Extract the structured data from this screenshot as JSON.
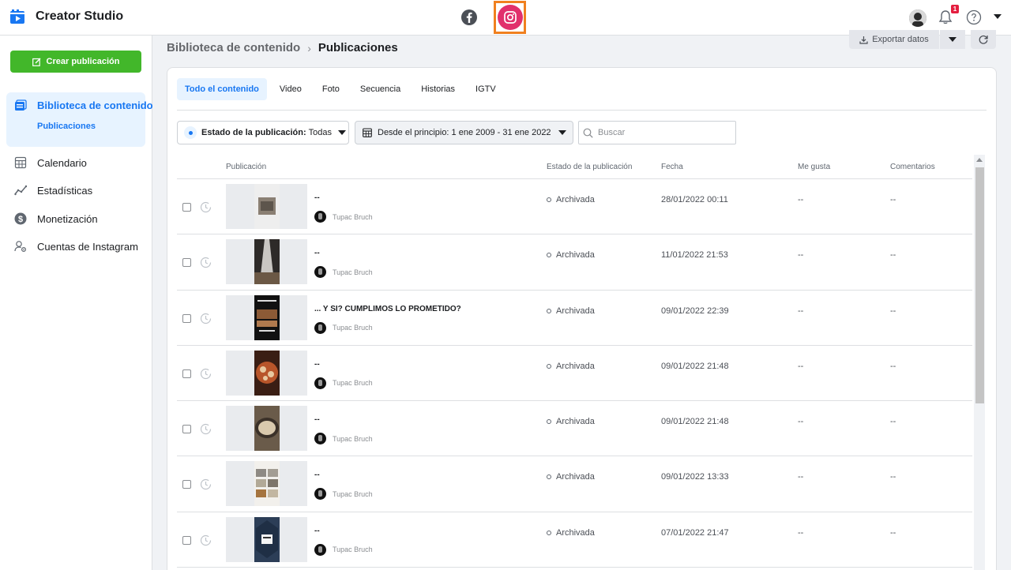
{
  "app": {
    "title": "Creator Studio"
  },
  "topbar": {
    "notification_count": "1"
  },
  "sidebar": {
    "create_label": "Crear publicación",
    "active_item": {
      "label": "Biblioteca de contenido",
      "sub": "Publicaciones"
    },
    "items": [
      {
        "label": "Calendario",
        "icon": "calendar-icon"
      },
      {
        "label": "Estadísticas",
        "icon": "stats-icon"
      },
      {
        "label": "Monetización",
        "icon": "dollar-icon"
      },
      {
        "label": "Cuentas de Instagram",
        "icon": "account-settings-icon"
      }
    ]
  },
  "breadcrumb": {
    "parent": "Biblioteca de contenido",
    "current": "Publicaciones"
  },
  "toolbar": {
    "export_label": "Exportar datos"
  },
  "tabs": [
    "Todo el contenido",
    "Video",
    "Foto",
    "Secuencia",
    "Historias",
    "IGTV"
  ],
  "filters": {
    "status_label": "Estado de la publicación:",
    "status_value": "Todas",
    "date_range": "Desde el principio: 1 ene 2009 - 31 ene 2022",
    "search_placeholder": "Buscar"
  },
  "table": {
    "columns": [
      "Publicación",
      "Estado de la publicación",
      "Fecha",
      "Me gusta",
      "Comentarios"
    ],
    "rows": [
      {
        "title": "--",
        "author": "Tupac Bruch",
        "status": "Archivada",
        "date": "28/01/2022 00:11",
        "likes": "--",
        "comments": "--"
      },
      {
        "title": "--",
        "author": "Tupac Bruch",
        "status": "Archivada",
        "date": "11/01/2022 21:53",
        "likes": "--",
        "comments": "--"
      },
      {
        "title": "... Y SI? CUMPLIMOS LO PROMETIDO?",
        "author": "Tupac Bruch",
        "status": "Archivada",
        "date": "09/01/2022 22:39",
        "likes": "--",
        "comments": "--"
      },
      {
        "title": "--",
        "author": "Tupac Bruch",
        "status": "Archivada",
        "date": "09/01/2022 21:48",
        "likes": "--",
        "comments": "--"
      },
      {
        "title": "--",
        "author": "Tupac Bruch",
        "status": "Archivada",
        "date": "09/01/2022 21:48",
        "likes": "--",
        "comments": "--"
      },
      {
        "title": "--",
        "author": "Tupac Bruch",
        "status": "Archivada",
        "date": "09/01/2022 13:33",
        "likes": "--",
        "comments": "--"
      },
      {
        "title": "--",
        "author": "Tupac Bruch",
        "status": "Archivada",
        "date": "07/01/2022 21:47",
        "likes": "--",
        "comments": "--"
      }
    ]
  },
  "colors": {
    "accent": "#1877f2",
    "create": "#42b72a",
    "instagram": "#e1306c",
    "highlight": "#f0801f"
  }
}
